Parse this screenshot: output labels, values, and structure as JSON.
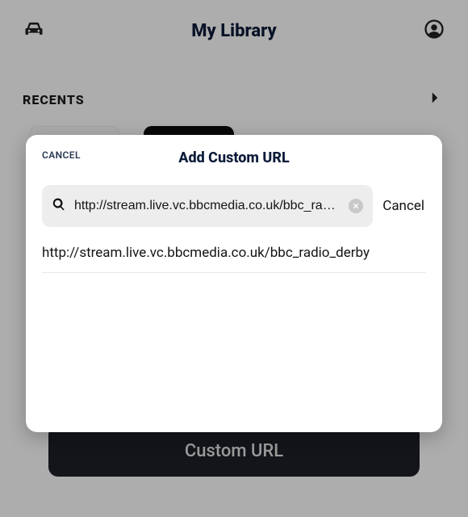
{
  "header": {
    "title": "My Library"
  },
  "recents": {
    "label": "RECENTS"
  },
  "custom_url_button": "Custom URL",
  "modal": {
    "top_cancel": "CANCEL",
    "title": "Add Custom URL",
    "input_value": "http://stream.live.vc.bbcmedia.co.uk/bbc_radio_de…",
    "side_cancel": "Cancel",
    "result": "http://stream.live.vc.bbcmedia.co.uk/bbc_radio_derby"
  }
}
